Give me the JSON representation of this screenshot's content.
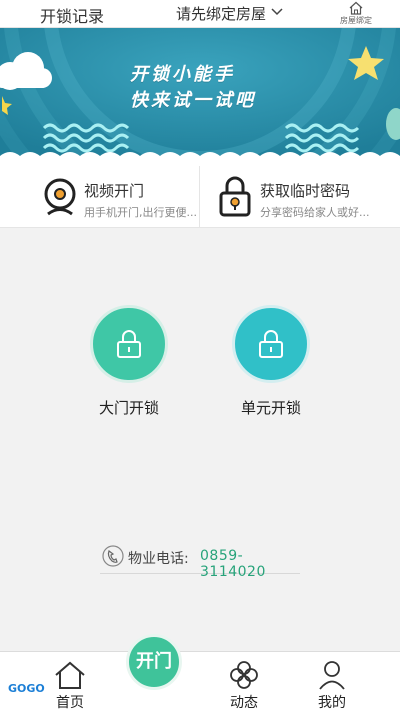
{
  "header": {
    "records_label": "开锁记录",
    "bind_label": "请先绑定房屋",
    "house_bind_label": "房屋绑定"
  },
  "banner": {
    "line1": "开锁小能手",
    "line2": "快来试一试吧"
  },
  "features": [
    {
      "title": "视频开门",
      "subtitle": "用手机开门,出行更便..."
    },
    {
      "title": "获取临时密码",
      "subtitle": "分享密码给家人或好..."
    }
  ],
  "doors": [
    {
      "label": "大门开锁",
      "color": "#3fc7a6"
    },
    {
      "label": "单元开锁",
      "color": "#30c0c8"
    }
  ],
  "property": {
    "label": "物业电话:",
    "phone": "0859-3114020"
  },
  "nav": {
    "home": "首页",
    "open": "开门",
    "dynamic": "动态",
    "mine": "我的"
  },
  "watermark": "GOGO"
}
